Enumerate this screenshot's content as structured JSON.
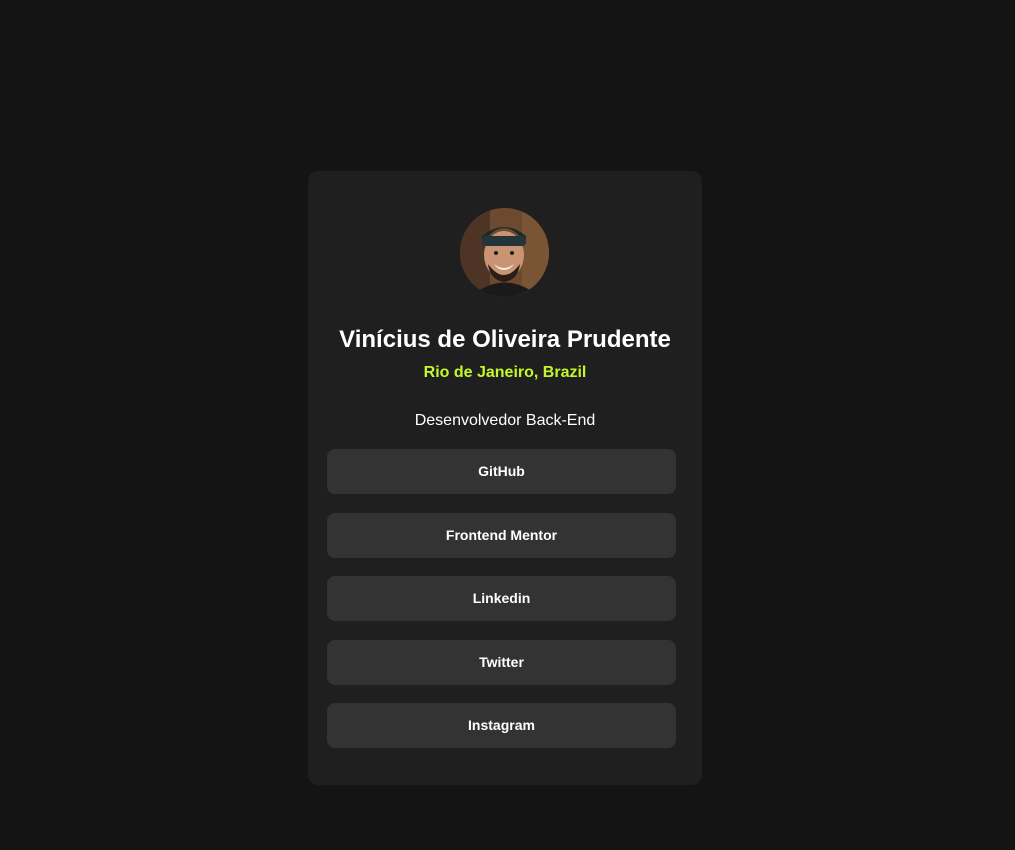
{
  "profile": {
    "name": "Vinícius de Oliveira Prudente",
    "location": "Rio de Janeiro, Brazil",
    "bio": "Desenvolvedor Back-End",
    "avatar_icon": "profile-photo"
  },
  "links": [
    {
      "label": "GitHub"
    },
    {
      "label": "Frontend Mentor"
    },
    {
      "label": "Linkedin"
    },
    {
      "label": "Twitter"
    },
    {
      "label": "Instagram"
    }
  ],
  "colors": {
    "page_background": "#141414",
    "card_background": "#1f1f1f",
    "button_background": "#333333",
    "accent": "#c4f82a",
    "text": "#ffffff"
  }
}
